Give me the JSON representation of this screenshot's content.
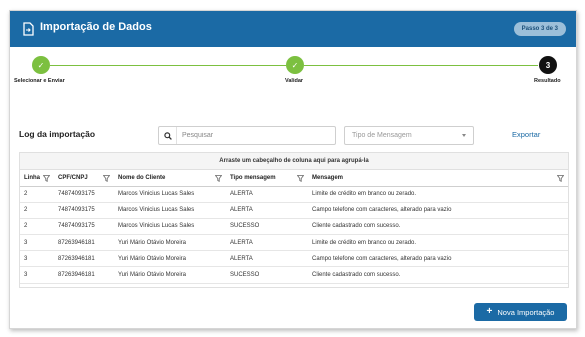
{
  "header": {
    "title": "Importação de Dados",
    "badge": "Passo 3 de 3"
  },
  "stepper": {
    "steps": [
      {
        "label": "Selecionar e Enviar",
        "status": "done",
        "marker": "✓"
      },
      {
        "label": "Validar",
        "status": "done",
        "marker": "✓"
      },
      {
        "label": "Resultado",
        "status": "current",
        "marker": "3"
      }
    ]
  },
  "log": {
    "title": "Log da importação",
    "search_placeholder": "Pesquisar",
    "type_placeholder": "Tipo de Mensagem",
    "export_label": "Exportar"
  },
  "grid": {
    "group_hint": "Arraste um cabeçalho de coluna aqui para agrupá-la",
    "columns": [
      "Linha",
      "CPF/CNPJ",
      "Nome do Cliente",
      "Tipo mensagem",
      "Mensagem"
    ],
    "rows": [
      [
        "2",
        "74874093175",
        "Marcos Vinicius Lucas Sales",
        "ALERTA",
        "Limite de crédito em branco ou zerado."
      ],
      [
        "2",
        "74874093175",
        "Marcos Vinicius Lucas Sales",
        "ALERTA",
        "Campo telefone com caracteres, alterado para vazio"
      ],
      [
        "2",
        "74874093175",
        "Marcos Vinicius Lucas Sales",
        "SUCESSO",
        "Cliente cadastrado com sucesso."
      ],
      [
        "3",
        "87263946181",
        "Yuri Mário Otávio Moreira",
        "ALERTA",
        "Limite de crédito em branco ou zerado."
      ],
      [
        "3",
        "87263946181",
        "Yuri Mário Otávio Moreira",
        "ALERTA",
        "Campo telefone com caracteres, alterado para vazio"
      ],
      [
        "3",
        "87263946181",
        "Yuri Mário Otávio Moreira",
        "SUCESSO",
        "Cliente cadastrado com sucesso."
      ]
    ]
  },
  "actions": {
    "new_import_label": "Nova Importação"
  },
  "colors": {
    "primary": "#1b6aa5",
    "step_done": "#7cc040",
    "step_current": "#111111"
  },
  "icons": {
    "header": "document-import-icon",
    "search": "search-icon",
    "filter": "filter-icon",
    "check": "check-icon",
    "plus": "plus-icon"
  }
}
